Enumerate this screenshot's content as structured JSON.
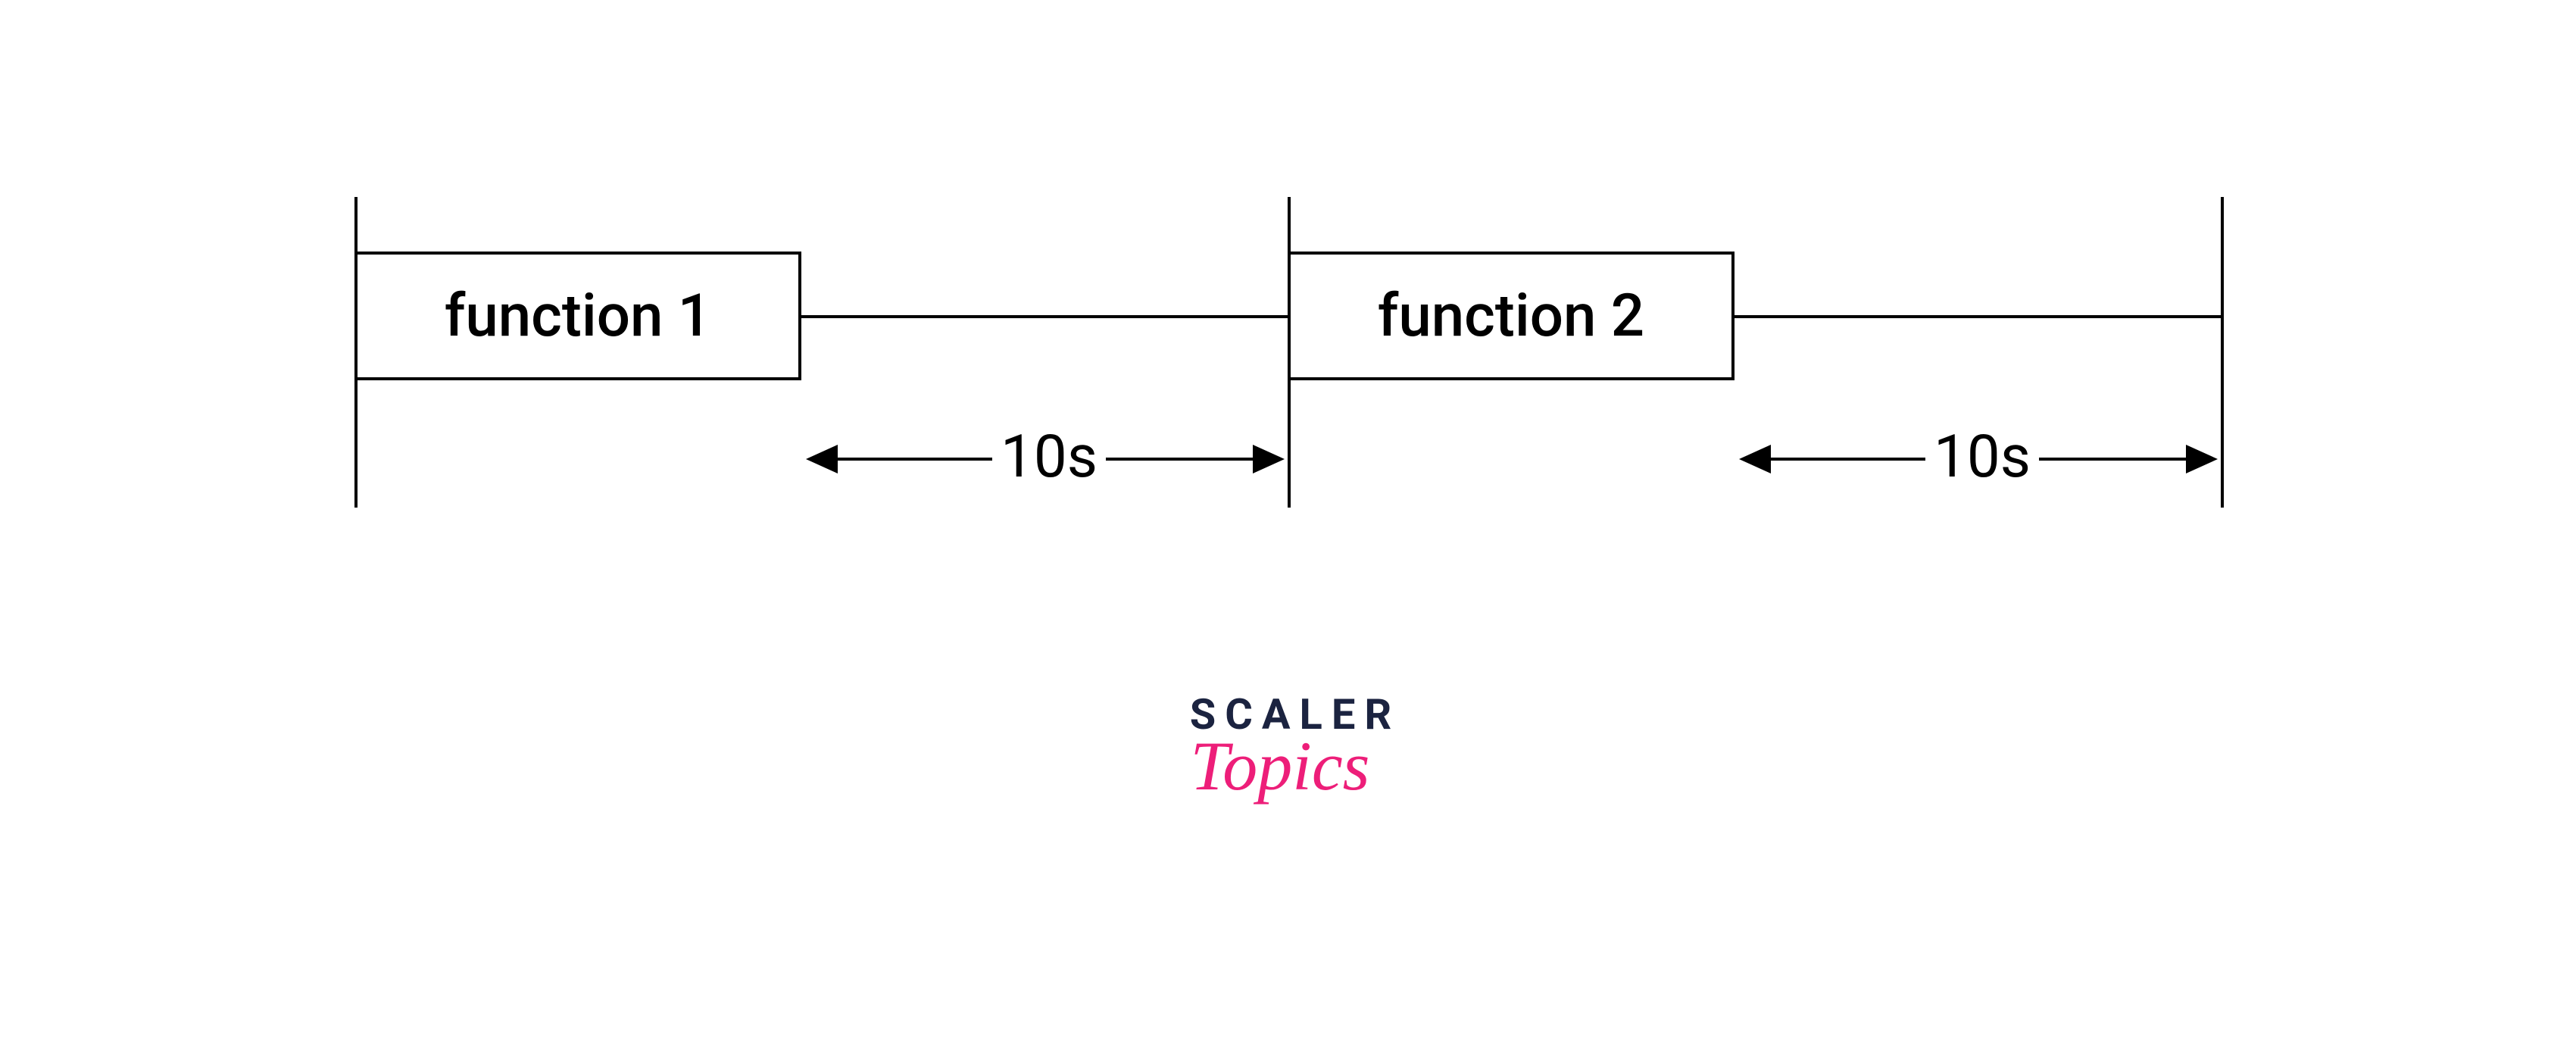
{
  "diagram": {
    "function1_label": "function 1",
    "function2_label": "function 2",
    "interval1_label": "10s",
    "interval2_label": "10s"
  },
  "logo": {
    "line1": "SCALER",
    "line2": "Topics"
  },
  "chart_data": {
    "type": "timeline-diagram",
    "description": "A conceptual timing diagram showing two function executions separated by fixed intervals.",
    "events": [
      {
        "name": "function 1",
        "followed_by_interval": "10s"
      },
      {
        "name": "function 2",
        "followed_by_interval": "10s"
      }
    ],
    "interval_unit": "seconds",
    "interval_value": 10
  }
}
